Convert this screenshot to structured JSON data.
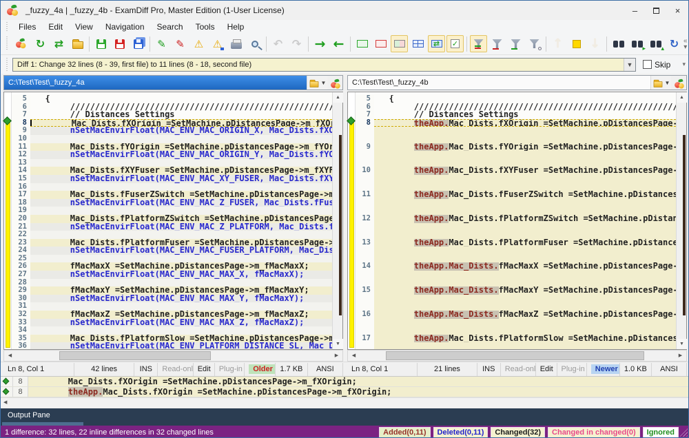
{
  "window": {
    "title": "_fuzzy_4a  |  _fuzzy_4b - ExamDiff Pro, Master Edition (1-User License)"
  },
  "menu": [
    "Files",
    "Edit",
    "View",
    "Navigation",
    "Search",
    "Tools",
    "Help"
  ],
  "toolbar": {
    "groups": [
      [
        {
          "name": "compare-files"
        },
        {
          "name": "recompare"
        },
        {
          "name": "swap-panes"
        },
        {
          "name": "open-session"
        }
      ],
      [
        {
          "name": "save-first-file"
        },
        {
          "name": "save-second-file"
        },
        {
          "name": "save-both-files"
        }
      ],
      [
        {
          "name": "edit-first-file"
        },
        {
          "name": "edit-second-file"
        },
        {
          "name": "save-report-first"
        },
        {
          "name": "save-report-second"
        },
        {
          "name": "print"
        },
        {
          "name": "zoom-view"
        }
      ],
      [
        {
          "name": "undo",
          "disabled": true
        },
        {
          "name": "redo",
          "disabled": true
        }
      ],
      [
        {
          "name": "copy-block-right"
        },
        {
          "name": "copy-block-left"
        }
      ],
      [
        {
          "name": "show-added"
        },
        {
          "name": "show-deleted"
        },
        {
          "name": "show-changed",
          "active": true
        },
        {
          "name": "show-all"
        },
        {
          "name": "synchronize-scrolling",
          "active": true
        },
        {
          "name": "show-checkmarks",
          "active": true
        }
      ],
      [
        {
          "name": "filter-all",
          "active": true
        },
        {
          "name": "filter-deleted"
        },
        {
          "name": "filter-added"
        },
        {
          "name": "filter-options"
        }
      ],
      [
        {
          "name": "previous-difference",
          "disabled": true
        },
        {
          "name": "current-difference"
        },
        {
          "name": "next-difference",
          "disabled": true
        }
      ],
      [
        {
          "name": "find"
        },
        {
          "name": "find-next"
        },
        {
          "name": "find-previous"
        },
        {
          "name": "refresh-comparison"
        }
      ]
    ]
  },
  "diffbar": {
    "combo_value": "Diff 1: Change 32 lines (8 - 39, first file) to 11 lines (8 - 18, second file)",
    "skip_label": "Skip"
  },
  "left_pane": {
    "path": "C:\\Test\\Test\\_fuzzy_4a",
    "status": [
      {
        "text": "Ln 8, Col 1",
        "w": 128,
        "first": true
      },
      {
        "text": "42 lines",
        "w": 108
      },
      {
        "text": "INS",
        "w": 40
      },
      {
        "text": "Read-only",
        "w": 62,
        "muted": true
      },
      {
        "text": "Edit",
        "w": 36
      },
      {
        "text": "Plug-in",
        "w": 52,
        "muted": true
      },
      {
        "text": "Older",
        "w": 0,
        "style": "older"
      },
      {
        "text": "1.7 KB",
        "w": 56
      },
      {
        "text": "ANSI",
        "w": 62
      }
    ],
    "lines": [
      {
        "num": 5,
        "text": "   {",
        "type": "normal"
      },
      {
        "num": 6,
        "text": "        //////////////////////////////////////////////////////////////////////////////",
        "type": "normal"
      },
      {
        "num": 7,
        "text": "        // Distances Settings",
        "type": "normal"
      },
      {
        "num": 8,
        "text": "Mac_Dists.fXOrigin =SetMachine.pDistancesPage->m_fXOrigin;",
        "indent": "        ",
        "type": "current"
      },
      {
        "num": 9,
        "text": "        nSetMacEnvirFloat(MAC_ENV_MAC_ORIGIN_X, Mac_Dists.fXOrigin);",
        "type": "deleted"
      },
      {
        "num": 10,
        "text": "",
        "type": "empty"
      },
      {
        "num": 11,
        "text": "        Mac_Dists.fYOrigin =SetMachine.pDistancesPage->m_fYOrigin;",
        "type": "changed"
      },
      {
        "num": 12,
        "text": "        nSetMacEnvirFloat(MAC_ENV_MAC_ORIGIN_Y, Mac_Dists.fYOrigin);",
        "type": "deleted"
      },
      {
        "num": 13,
        "text": "",
        "type": "empty"
      },
      {
        "num": 14,
        "text": "        Mac_Dists.fXYFuser =SetMachine.pDistancesPage->m_fXYFuser;",
        "type": "changed"
      },
      {
        "num": 15,
        "text": "        nSetMacEnvirFloat(MAC_ENV_MAC_XY_FUSER, Mac_Dists.fXYFuser);",
        "type": "deleted"
      },
      {
        "num": 16,
        "text": "",
        "type": "empty"
      },
      {
        "num": 17,
        "text": "        Mac_Dists.fFuserZSwitch =SetMachine.pDistancesPage->m_fFuserZSwitch;",
        "type": "changed"
      },
      {
        "num": 18,
        "text": "        nSetMacEnvirFloat(MAC_ENV_MAC_Z_FUSER, Mac_Dists.fFuserZSwitch);",
        "type": "deleted"
      },
      {
        "num": 19,
        "text": "",
        "type": "empty"
      },
      {
        "num": 20,
        "text": "        Mac_Dists.fPlatformZSwitch =SetMachine.pDistancesPage->m_fPlatformZSwitch;",
        "type": "changed"
      },
      {
        "num": 21,
        "text": "        nSetMacEnvirFloat(MAC_ENV_MAC_Z_PLATFORM, Mac_Dists.fPlatformZSwitch);",
        "type": "deleted"
      },
      {
        "num": 22,
        "text": "",
        "type": "empty"
      },
      {
        "num": 23,
        "text": "        Mac_Dists.fPlatformFuser =SetMachine.pDistancesPage->m_fPlatformFuser;",
        "type": "changed"
      },
      {
        "num": 24,
        "text": "        nSetMacEnvirFloat(MAC_ENV_MAC_FUSER_PLATFORM, Mac_Dists.fPlatformFuser);",
        "type": "deleted"
      },
      {
        "num": 25,
        "text": "",
        "type": "empty"
      },
      {
        "num": 26,
        "text": "        fMacMaxX =SetMachine.pDistancesPage->m_fMacMaxX;",
        "type": "changed"
      },
      {
        "num": 27,
        "text": "        nSetMacEnvirFloat(MAC_ENV_MAC_MAX_X, fMacMaxX);",
        "type": "deleted"
      },
      {
        "num": 28,
        "text": "",
        "type": "empty"
      },
      {
        "num": 29,
        "text": "        fMacMaxY =SetMachine.pDistancesPage->m_fMacMaxY;",
        "type": "changed"
      },
      {
        "num": 30,
        "text": "        nSetMacEnvirFloat(MAC_ENV_MAC_MAX_Y, fMacMaxY);",
        "type": "deleted"
      },
      {
        "num": 31,
        "text": "",
        "type": "empty"
      },
      {
        "num": 32,
        "text": "        fMacMaxZ =SetMachine.pDistancesPage->m_fMacMaxZ;",
        "type": "changed"
      },
      {
        "num": 33,
        "text": "        nSetMacEnvirFloat(MAC_ENV_MAC_MAX_Z, fMacMaxZ);",
        "type": "deleted"
      },
      {
        "num": 34,
        "text": "",
        "type": "empty"
      },
      {
        "num": 35,
        "text": "        Mac_Dists.fPlatformSlow =SetMachine.pDistancesPage->m_fPlatformSlow;",
        "type": "changed"
      },
      {
        "num": 36,
        "text": "        nSetMacEnvirFloat(MAC_ENV_PLATFORM_DISTANCE_SL, Mac_Dists.fPlatformSlow);",
        "type": "deleted"
      }
    ]
  },
  "right_pane": {
    "path": "C:\\Test\\Test\\_fuzzy_4b",
    "status": [
      {
        "text": "Ln 8, Col 1",
        "w": 128,
        "first": true
      },
      {
        "text": "21 lines",
        "w": 108
      },
      {
        "text": "INS",
        "w": 40
      },
      {
        "text": "Read-only",
        "w": 62,
        "muted": true
      },
      {
        "text": "Edit",
        "w": 36
      },
      {
        "text": "Plug-in",
        "w": 52,
        "muted": true
      },
      {
        "text": "Newer",
        "w": 0,
        "style": "newer"
      },
      {
        "text": "1.0 KB",
        "w": 56
      },
      {
        "text": "ANSI",
        "w": 62
      }
    ],
    "lines": [
      {
        "num": 5,
        "text": "   {",
        "type": "normal"
      },
      {
        "num": 6,
        "text": "        //////////////////////////////////////////////////////////////////////////////",
        "type": "normal"
      },
      {
        "num": 7,
        "text": "        // Distances Settings",
        "type": "normal"
      },
      {
        "num": 8,
        "indent": "        ",
        "hl": "theApp.",
        "text": "Mac_Dists.fXOrigin =SetMachine.pDistancesPage->m_fXOrigin;",
        "type": "current"
      },
      {
        "type": "filler"
      },
      {
        "type": "filler"
      },
      {
        "num": 9,
        "indent": "        ",
        "hl": "theApp.",
        "text": "Mac_Dists.fYOrigin =SetMachine.pDistancesPage->m_fYOrigin;",
        "type": "changed"
      },
      {
        "type": "filler"
      },
      {
        "type": "filler"
      },
      {
        "num": 10,
        "indent": "        ",
        "hl": "theApp.",
        "text": "Mac_Dists.fXYFuser =SetMachine.pDistancesPage->m_fXYFuser;",
        "type": "changed"
      },
      {
        "type": "filler"
      },
      {
        "type": "filler"
      },
      {
        "num": 11,
        "indent": "        ",
        "hl": "theApp.",
        "text": "Mac_Dists.fFuserZSwitch =SetMachine.pDistancesPage->m_fFuserZSwitch;",
        "type": "changed"
      },
      {
        "type": "filler"
      },
      {
        "type": "filler"
      },
      {
        "num": 12,
        "indent": "        ",
        "hl": "theApp.",
        "text": "Mac_Dists.fPlatformZSwitch =SetMachine.pDistancesPage->m_fPlatformZSwitch;",
        "type": "changed"
      },
      {
        "type": "filler"
      },
      {
        "type": "filler"
      },
      {
        "num": 13,
        "indent": "        ",
        "hl": "theApp.",
        "text": "Mac_Dists.fPlatformFuser =SetMachine.pDistancesPage->m_fPlatformFuser;",
        "type": "changed"
      },
      {
        "type": "filler"
      },
      {
        "type": "filler"
      },
      {
        "num": 14,
        "indent": "        ",
        "hl": "theApp.Mac_Dists.",
        "text": "fMacMaxX =SetMachine.pDistancesPage->m_fMacMaxX;",
        "type": "changed"
      },
      {
        "type": "filler"
      },
      {
        "type": "filler"
      },
      {
        "num": 15,
        "indent": "        ",
        "hl": "theApp.Mac_Dists.",
        "text": "fMacMaxY =SetMachine.pDistancesPage->m_fMacMaxY;",
        "type": "changed"
      },
      {
        "type": "filler"
      },
      {
        "type": "filler"
      },
      {
        "num": 16,
        "indent": "        ",
        "hl": "theApp.Mac_Dists.",
        "text": "fMacMaxZ =SetMachine.pDistancesPage->m_fMacMaxZ;",
        "type": "changed"
      },
      {
        "type": "filler"
      },
      {
        "type": "filler"
      },
      {
        "num": 17,
        "indent": "        ",
        "hl": "theApp.",
        "text": "Mac_Dists.fPlatformSlow =SetMachine.pDistancesPage->m_fPlatformSlow;",
        "type": "changed"
      },
      {
        "type": "filler"
      }
    ]
  },
  "inspector": {
    "rows": [
      {
        "line": "8",
        "indent": "        ",
        "hl": "",
        "text": "Mac_Dists.fXOrigin =SetMachine.pDistancesPage->m_fXOrigin;"
      },
      {
        "line": "8",
        "indent": "        ",
        "hl": "theApp.",
        "text": "Mac_Dists.fXOrigin =SetMachine.pDistancesPage->m_fXOrigin;"
      }
    ]
  },
  "output_pane": {
    "title": "Output Pane"
  },
  "statusbar": {
    "summary": "1 difference: 32 lines, 22 inline differences in 32 changed lines",
    "badges": [
      {
        "text": "Added(0,11)",
        "style": "added"
      },
      {
        "text": "Deleted(0,11)",
        "style": "deleted"
      },
      {
        "text": "Changed(32)",
        "style": "changed"
      },
      {
        "text": "Changed in changed(0)",
        "style": "cic"
      },
      {
        "text": "Ignored",
        "style": "ignored"
      }
    ]
  },
  "colors": {
    "header_active_blue": "#1E67C0",
    "diff_changed_bg": "#F2EECE",
    "diff_deleted_text": "#2929CC",
    "inline_change_text": "#8C2A20",
    "map_bar_yellow": "#FFF200",
    "statusbar_purple": "#7B2382"
  }
}
